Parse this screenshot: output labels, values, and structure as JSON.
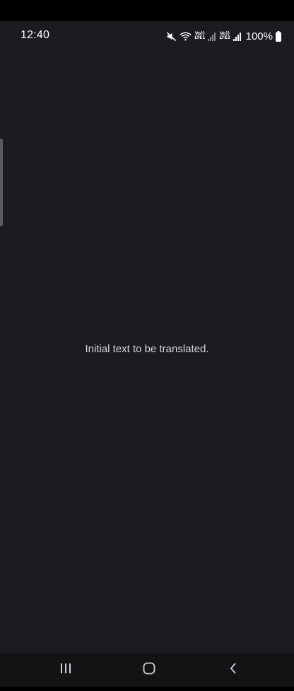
{
  "status_bar": {
    "time": "12:40",
    "volte1_top": "Vo))",
    "volte1_bottom": "LTE1",
    "volte2_top": "Vo))",
    "volte2_bottom": "LTE2",
    "battery": "100%",
    "icons": [
      "mute-icon",
      "wifi-icon",
      "signal-icon",
      "signal-icon",
      "battery-icon"
    ]
  },
  "main": {
    "text": "Initial text to be translated."
  },
  "nav": {
    "icons": [
      "recent-apps-icon",
      "home-icon",
      "back-icon"
    ]
  },
  "colors": {
    "background": "#1c1c20",
    "text": "#d6d6da",
    "nav_background": "#131316"
  }
}
